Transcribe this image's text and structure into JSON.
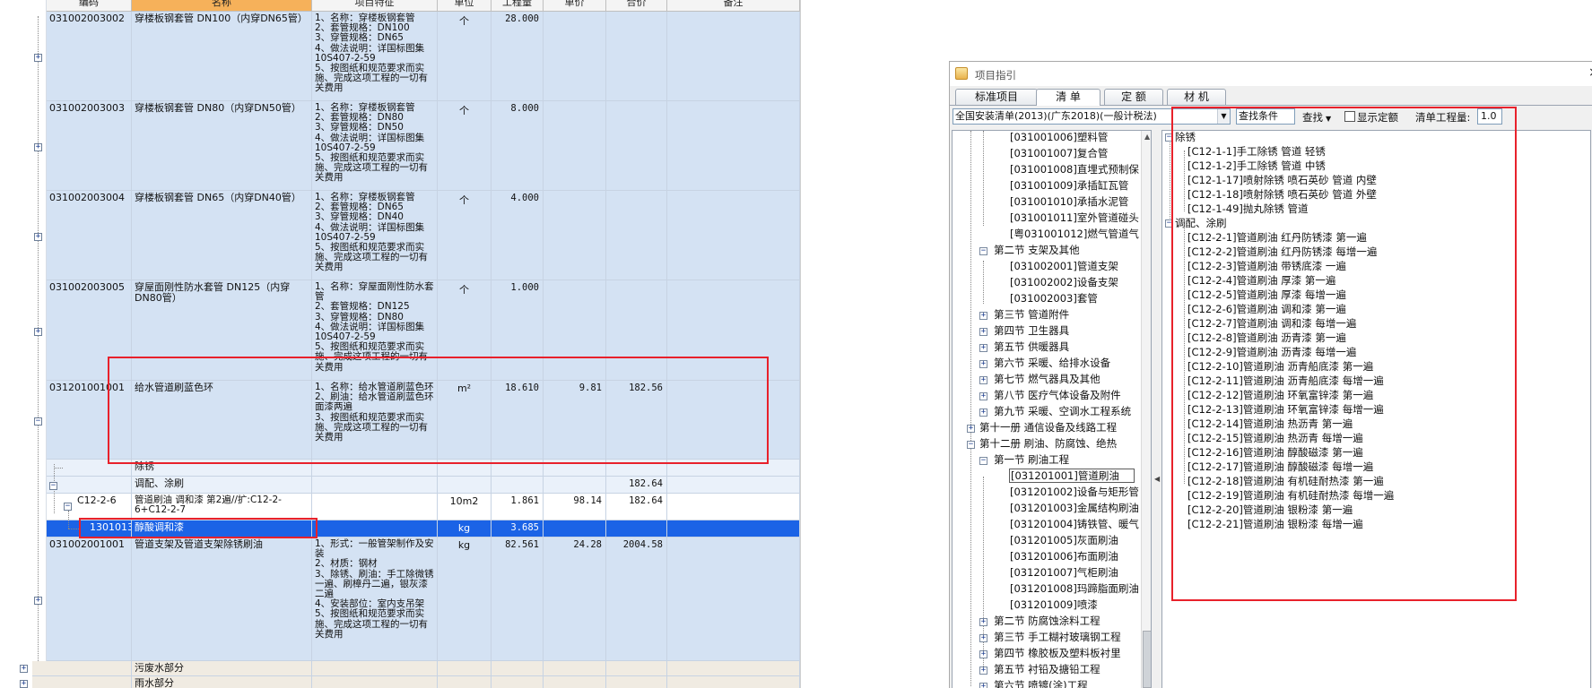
{
  "grid": {
    "headers": [
      "编码",
      "名称",
      "项目特征",
      "单位",
      "工程量",
      "单价",
      "合价",
      "备注"
    ],
    "rows": [
      {
        "code": "031002003002",
        "name": "穿楼板钢套管 DN100（内穿DN65管）",
        "feature": "1、名称：穿楼板钢套管\n2、套管规格：DN100\n3、穿管规格：DN65\n4、做法说明：详国标图集10S407-2-59\n5、按图纸和规范要求而实施、完成这项工程的一切有关费用",
        "unit": "个",
        "qty": "28.000",
        "price": "",
        "total": ""
      },
      {
        "code": "031002003003",
        "name": "穿楼板钢套管 DN80（内穿DN50管）",
        "feature": "1、名称：穿楼板钢套管\n2、套管规格：DN80\n3、穿管规格：DN50\n4、做法说明：详国标图集10S407-2-59\n5、按图纸和规范要求而实施、完成这项工程的一切有关费用",
        "unit": "个",
        "qty": "8.000",
        "price": "",
        "total": ""
      },
      {
        "code": "031002003004",
        "name": "穿楼板钢套管 DN65（内穿DN40管）",
        "feature": "1、名称：穿楼板钢套管\n2、套管规格：DN65\n3、穿管规格：DN40\n4、做法说明：详国标图集10S407-2-59\n5、按图纸和规范要求而实施、完成这项工程的一切有关费用",
        "unit": "个",
        "qty": "4.000",
        "price": "",
        "total": ""
      },
      {
        "code": "031002003005",
        "name": "穿屋面刚性防水套管 DN125（内穿DN80管）",
        "feature": "1、名称：穿屋面刚性防水套管\n2、套管规格：DN125\n3、穿管规格：DN80\n4、做法说明：详国标图集10S407-2-59\n5、按图纸和规范要求而实施、完成这项工程的一切有关费用",
        "unit": "个",
        "qty": "1.000",
        "price": "",
        "total": ""
      },
      {
        "code": "031201001001",
        "name": "给水管道刷蓝色环",
        "feature": "1、名称：给水管道刷蓝色环\n2、刷油：给水管道刷蓝色环面漆两遍\n3、按图纸和规范要求而实施、完成这项工程的一切有关费用",
        "unit": "m²",
        "qty": "18.610",
        "price": "9.81",
        "total": "182.56"
      },
      {
        "code": "",
        "name": "除锈",
        "feature": "",
        "unit": "",
        "qty": "",
        "price": "",
        "total": ""
      },
      {
        "code": "",
        "name": "调配、涂刷",
        "feature": "",
        "unit": "",
        "qty": "",
        "price": "",
        "total": "182.64"
      },
      {
        "code": "C12-2-6",
        "name": "管道刷油 调和漆 第2遍//扩:C12-2-6+C12-2-7",
        "feature": "",
        "unit": "10m2",
        "qty": "1.861",
        "price": "98.14",
        "total": "182.64"
      },
      {
        "code": "1301013",
        "name": "醇酸调和漆",
        "feature": "",
        "unit": "kg",
        "qty": "3.685",
        "price": "",
        "total": ""
      },
      {
        "code": "031002001001",
        "name": "管道支架及管道支架除锈刷油",
        "feature": "1、形式：一般管架制作及安装\n2、材质：钢材\n3、除锈、刷油：手工除微锈一遍、刷樟丹二遍，银灰漆二遍\n4、安装部位：室内支吊架\n5、按图纸和规范要求而实施、完成这项工程的一切有关费用",
        "unit": "kg",
        "qty": "82.561",
        "price": "24.28",
        "total": "2004.58"
      },
      {
        "code": "",
        "name": "污废水部分",
        "feature": "",
        "unit": "",
        "qty": "",
        "price": "",
        "total": ""
      },
      {
        "code": "",
        "name": "雨水部分",
        "feature": "",
        "unit": "",
        "qty": "",
        "price": "",
        "total": ""
      }
    ]
  },
  "dialog": {
    "title": "项目指引",
    "close": "×",
    "tabs": [
      "标准项目",
      "清 单",
      "定 额",
      "材 机"
    ],
    "active_tab": 1,
    "combo_value": "全国安装清单(2013)(广东2018)(一般计税法)",
    "find_placeholder": "查找条件",
    "find_label": "查找",
    "show_quota_label": "显示定额",
    "qty_label": "清单工程量:",
    "qty_value": "1.0",
    "tree": [
      "[031001006]塑料管",
      "[031001007]复合管",
      "[031001008]直埋式预制保",
      "[031001009]承插缸瓦管",
      "[031001010]承插水泥管",
      "[031001011]室外管道碰头",
      "[粤031001012]燃气管道气",
      "第二节  支架及其他",
      "[031002001]管道支架",
      "[031002002]设备支架",
      "[031002003]套管",
      "第三节  管道附件",
      "第四节  卫生器具",
      "第五节  供暖器具",
      "第六节  采暖、给排水设备",
      "第七节 燃气器具及其他",
      "第八节  医疗气体设备及附件",
      "第九节 采暖、空调水工程系统",
      "第十一册  通信设备及线路工程",
      "第十二册  刷油、防腐蚀、绝热",
      "第一节  刷油工程",
      "[031201001]管道刷油",
      "[031201002]设备与矩形管",
      "[031201003]金属结构刷油",
      "[031201004]铸铁管、暖气",
      "[031201005]灰面刷油",
      "[031201006]布面刷油",
      "[031201007]气柜刷油",
      "[031201008]玛蹄脂面刷油",
      "[031201009]喷漆",
      "第二节  防腐蚀涂料工程",
      "第三节  手工糊衬玻璃钢工程",
      "第四节  橡胶板及塑料板衬里",
      "第五节  衬铅及搪铅工程",
      "第六节  喷镀(涂)工程"
    ],
    "quota_groups": [
      {
        "title": "除锈",
        "items": [
          "[C12-1-1]手工除锈 管道 轻锈",
          "[C12-1-2]手工除锈 管道 中锈",
          "[C12-1-17]喷射除锈 喷石英砂 管道 内壁",
          "[C12-1-18]喷射除锈 喷石英砂 管道 外壁",
          "[C12-1-49]抛丸除锈 管道"
        ]
      },
      {
        "title": "调配、涂刷",
        "items": [
          "[C12-2-1]管道刷油 红丹防锈漆 第一遍",
          "[C12-2-2]管道刷油 红丹防锈漆 每增一遍",
          "[C12-2-3]管道刷油 带锈底漆 一遍",
          "[C12-2-4]管道刷油 厚漆 第一遍",
          "[C12-2-5]管道刷油 厚漆 每增一遍",
          "[C12-2-6]管道刷油 调和漆 第一遍",
          "[C12-2-7]管道刷油 调和漆 每增一遍",
          "[C12-2-8]管道刷油 沥青漆 第一遍",
          "[C12-2-9]管道刷油 沥青漆 每增一遍",
          "[C12-2-10]管道刷油 沥青船底漆 第一遍",
          "[C12-2-11]管道刷油 沥青船底漆 每增一遍",
          "[C12-2-12]管道刷油 环氧富锌漆 第一遍",
          "[C12-2-13]管道刷油 环氧富锌漆 每增一遍",
          "[C12-2-14]管道刷油 热沥青 第一遍",
          "[C12-2-15]管道刷油 热沥青 每增一遍",
          "[C12-2-16]管道刷油 醇酸磁漆 第一遍",
          "[C12-2-17]管道刷油 醇酸磁漆 每增一遍",
          "[C12-2-18]管道刷油 有机硅耐热漆 第一遍",
          "[C12-2-19]管道刷油 有机硅耐热漆 每增一遍",
          "[C12-2-20]管道刷油 银粉漆 第一遍",
          "[C12-2-21]管道刷油 银粉漆 每增一遍"
        ]
      }
    ]
  },
  "colors": {
    "item_row": "#d4e2f3",
    "selected_row": "#1b63e6",
    "selected_header": "#f6b15a",
    "annotation": "#e8212b"
  }
}
